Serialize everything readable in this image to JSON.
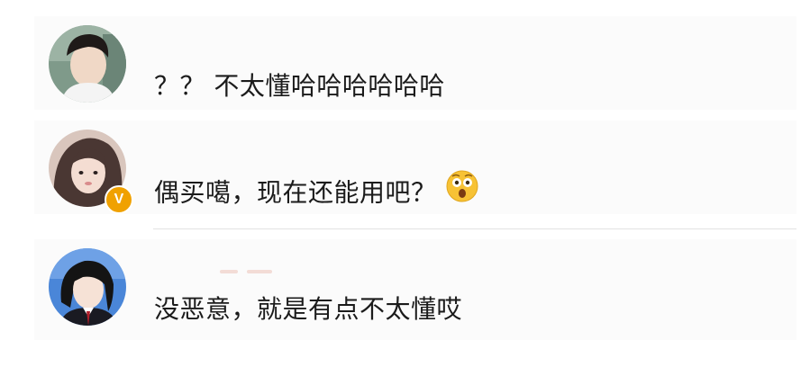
{
  "comments": [
    {
      "text": "？？ 不太懂哈哈哈哈哈哈",
      "verified": false
    },
    {
      "text": "偶买噶，现在还能用吧？",
      "verified": true,
      "verified_badge": "V",
      "emoji": "astonished-face-emoji"
    },
    {
      "text": "没恶意，就是有点不太懂哎",
      "verified": false
    }
  ],
  "colors": {
    "text": "#1b1b1b",
    "row_background": "#fbfbfb",
    "verified_badge": "#f0a100",
    "divider": "#e3e3e3"
  }
}
